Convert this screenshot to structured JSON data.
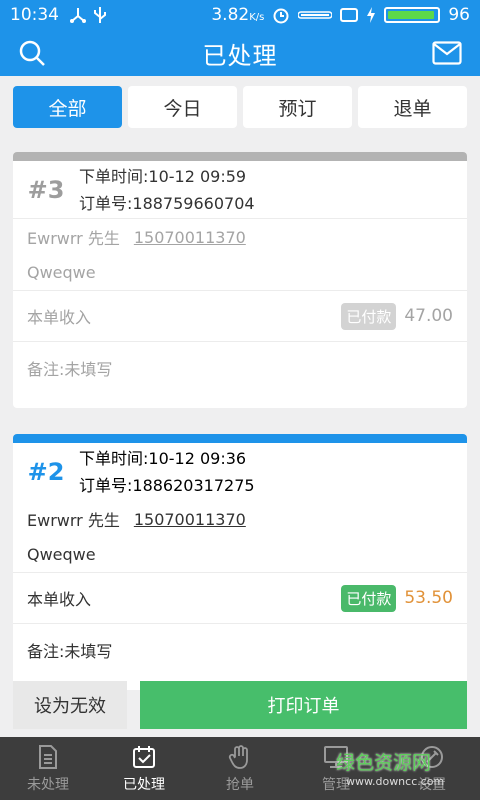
{
  "status_bar": {
    "time": "10:34",
    "speed": "3.82",
    "speed_unit": "K/s",
    "battery": "96",
    "battery_level": 0.96
  },
  "header": {
    "title": "已处理"
  },
  "tabs": [
    {
      "label": "全部",
      "active": true
    },
    {
      "label": "今日",
      "active": false
    },
    {
      "label": "预订",
      "active": false
    },
    {
      "label": "退单",
      "active": false
    }
  ],
  "orders": [
    {
      "number": "#3",
      "time_line": "下单时间:10-12 09:59",
      "order_line": "订单号:188759660704",
      "customer": "Ewrwrr 先生",
      "phone": "15070011370",
      "address": "Qweqwe",
      "income_label": "本单收入",
      "paid_label": "已付款",
      "amount": "47.00",
      "remark": "备注:未填写"
    },
    {
      "number": "#2",
      "time_line": "下单时间:10-12 09:36",
      "order_line": "订单号:188620317275",
      "customer": "Ewrwrr 先生",
      "phone": "15070011370",
      "address": "Qweqwe",
      "income_label": "本单收入",
      "paid_label": "已付款",
      "amount": "53.50",
      "remark": "备注:未填写"
    }
  ],
  "actions": {
    "invalid_label": "设为无效",
    "print_label": "打印订单"
  },
  "bottom_nav": [
    {
      "label": "未处理",
      "icon": "document-icon",
      "active": false
    },
    {
      "label": "已处理",
      "icon": "calendar-check-icon",
      "active": true
    },
    {
      "label": "抢单",
      "icon": "hand-icon",
      "active": false
    },
    {
      "label": "管理",
      "icon": "monitor-icon",
      "active": false
    },
    {
      "label": "设置",
      "icon": "wrench-icon",
      "active": false
    }
  ],
  "watermark": {
    "main": "绿色资源网",
    "sub": "www.downcc.com"
  },
  "colors": {
    "accent": "#1e93e9",
    "paid_green": "#4ab96a",
    "amount_orange": "#e19239",
    "print_green": "#47be6b"
  }
}
